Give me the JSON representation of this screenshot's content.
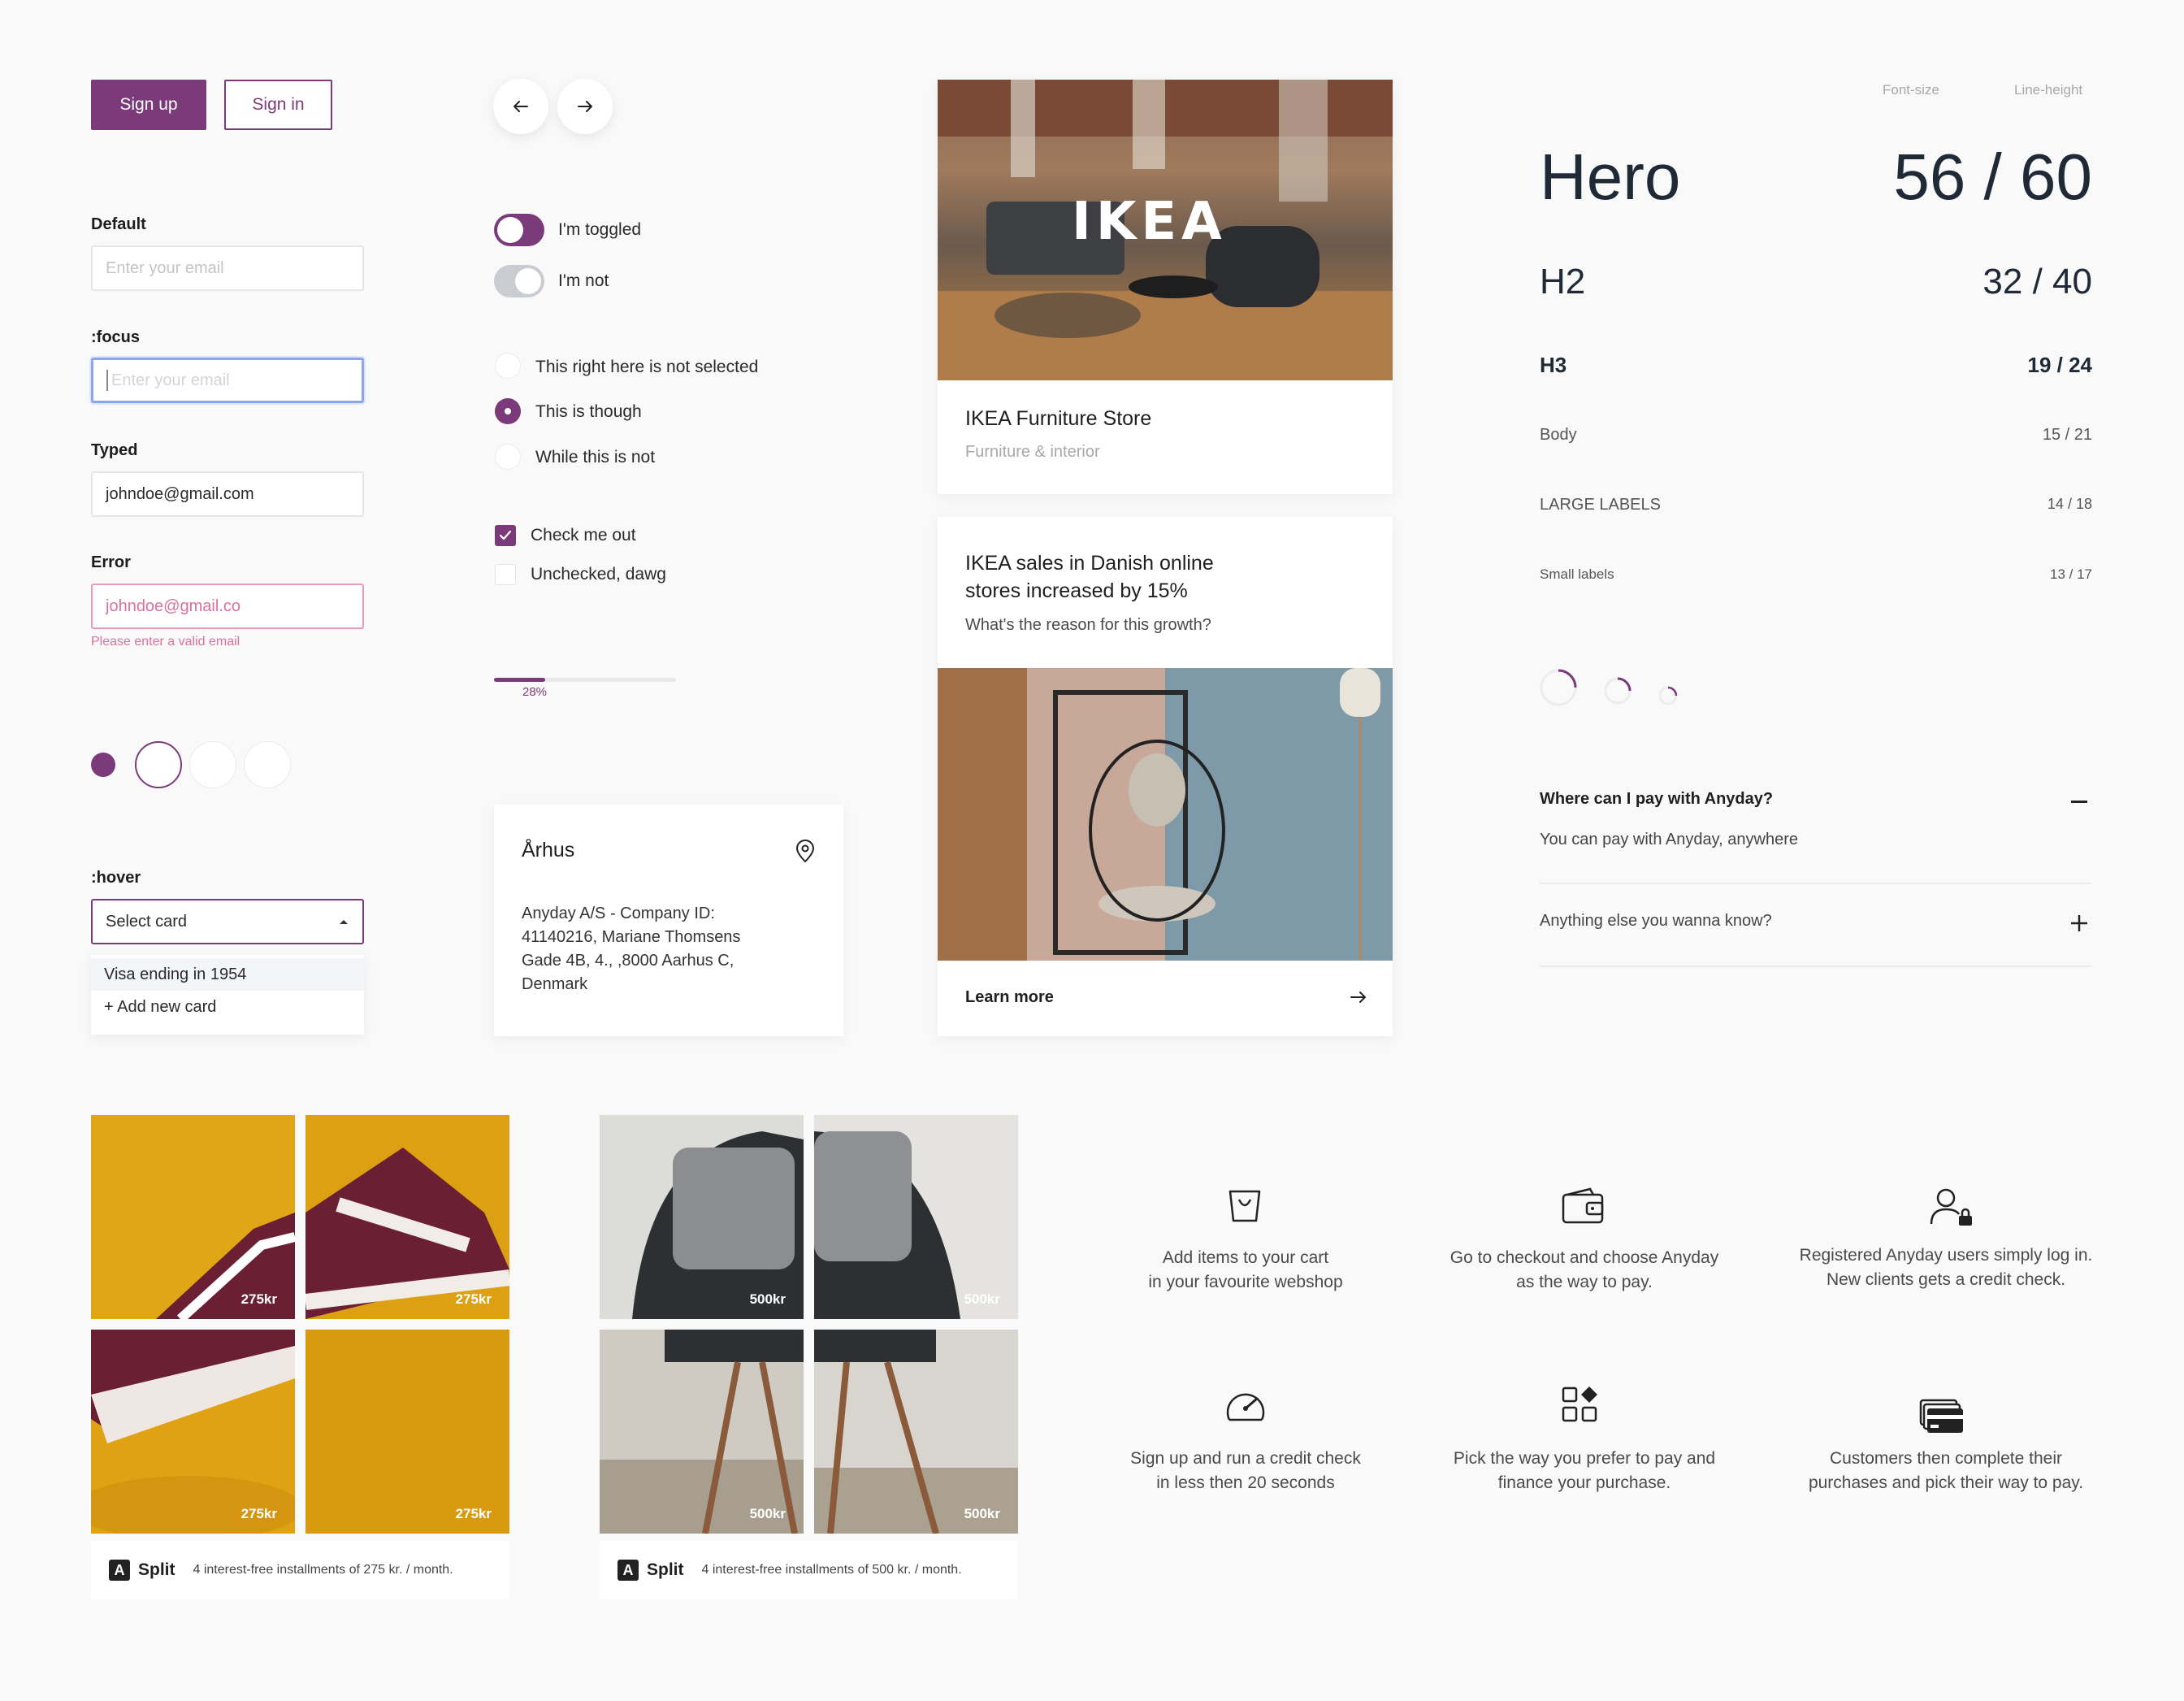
{
  "buttons": {
    "signup": "Sign up",
    "signin": "Sign in"
  },
  "inputs": {
    "default": {
      "label": "Default",
      "placeholder": "Enter your email"
    },
    "focus": {
      "label": ":focus",
      "placeholder": "Enter your email"
    },
    "typed": {
      "label": "Typed",
      "value": "johndoe@gmail.com"
    },
    "error": {
      "label": "Error",
      "value": "johndoe@gmail.co",
      "message": "Please enter a valid email"
    }
  },
  "select": {
    "label": ":hover",
    "value": "Select card",
    "options": [
      "Visa ending in 1954",
      "+ Add new card"
    ]
  },
  "toggles": [
    {
      "label": "I'm toggled",
      "on": true
    },
    {
      "label": "I'm not",
      "on": false
    }
  ],
  "radios": [
    {
      "label": "This right here is not selected",
      "selected": false
    },
    {
      "label": "This is though",
      "selected": true
    },
    {
      "label": "While this is not",
      "selected": false
    }
  ],
  "checkboxes": [
    {
      "label": "Check me out",
      "checked": true
    },
    {
      "label": "Unchecked, dawg",
      "checked": false
    }
  ],
  "progress": {
    "percent": 28,
    "label": "28%"
  },
  "address": {
    "city": "Århus",
    "text": "Anyday A/S - Company ID: 41140216, Mariane Thomsens Gade 4B, 4., ,8000 Aarhus C, Denmark"
  },
  "store_card": {
    "logo": "IKEA",
    "title": "IKEA Furniture Store",
    "subtitle": "Furniture & interior"
  },
  "article_card": {
    "title": "IKEA sales in Danish online stores increased by 15%",
    "subtitle": "What's the reason for this growth?",
    "link": "Learn more"
  },
  "typography": {
    "header_size": "Font-size",
    "header_line": "Line-height",
    "rows": [
      {
        "name": "Hero",
        "size": "56",
        "line": "60"
      },
      {
        "name": "H2",
        "size": "32",
        "line": "40"
      },
      {
        "name": "H3",
        "size": "19",
        "line": "24"
      },
      {
        "name": "Body",
        "size": "15",
        "line": "21"
      },
      {
        "name": "LARGE LABELS",
        "size": "14",
        "line": "18"
      },
      {
        "name": "Small labels",
        "size": "13",
        "line": "17"
      }
    ]
  },
  "faq": [
    {
      "question": "Where can I pay with Anyday?",
      "answer": "You can pay with Anyday, anywhere",
      "open": true
    },
    {
      "question": "Anything else you wanna know?",
      "open": false
    }
  ],
  "products": [
    {
      "prices": [
        "275kr",
        "275kr",
        "275kr",
        "275kr"
      ],
      "brand": "Split",
      "terms": "4 interest-free installments of 275 kr. / month."
    },
    {
      "prices": [
        "500kr",
        "500kr",
        "500kr",
        "500kr"
      ],
      "brand": "Split",
      "terms": "4 interest-free installments of 500 kr. / month."
    }
  ],
  "steps": [
    {
      "icon": "shopping-bag-icon",
      "text": [
        "Add items to your cart",
        "in your favourite webshop"
      ]
    },
    {
      "icon": "wallet-icon",
      "text": [
        "Go to checkout and choose Anyday",
        "as the way to pay."
      ]
    },
    {
      "icon": "user-lock-icon",
      "text": [
        "Registered Anyday users simply log in.",
        "New clients gets a credit check."
      ]
    },
    {
      "icon": "speedometer-icon",
      "text": [
        "Sign up and run a credit check",
        "in less then 20 seconds"
      ]
    },
    {
      "icon": "apps-icon",
      "text": [
        "Pick the way you prefer to pay and",
        "finance your purchase."
      ]
    },
    {
      "icon": "cards-icon",
      "text": [
        "Customers then complete their",
        "purchases and pick their way to pay."
      ]
    }
  ],
  "colors": {
    "primary": "#7b3a7a",
    "error": "#d9719a",
    "focus": "#8ea6e8"
  }
}
